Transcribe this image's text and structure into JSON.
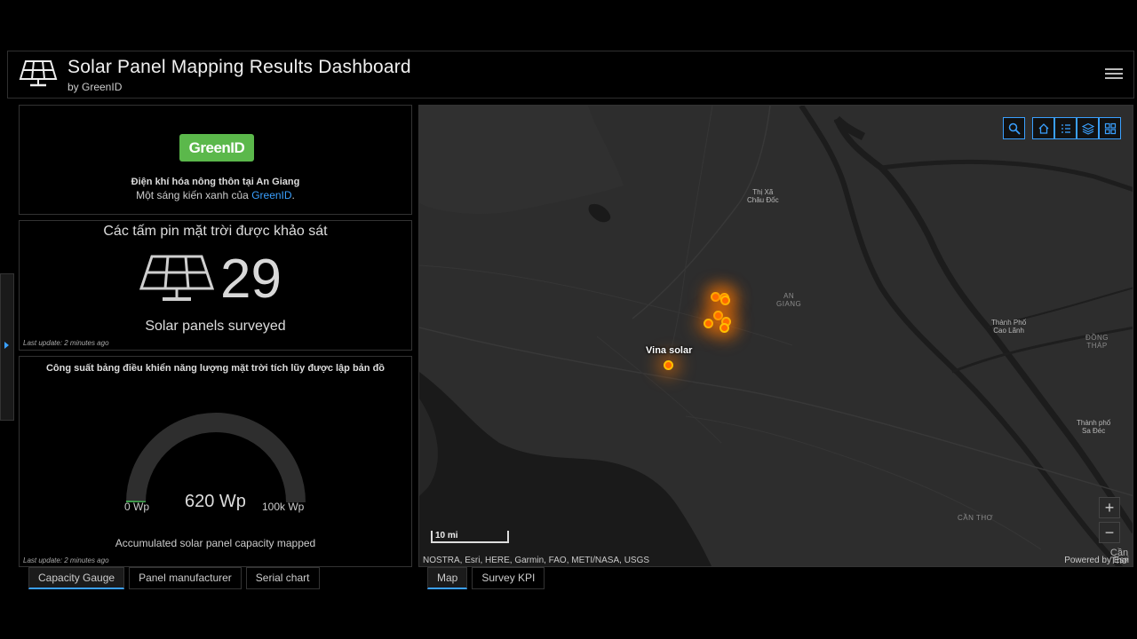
{
  "header": {
    "title": "Solar Panel Mapping Results Dashboard",
    "subtitle": "by GreenID"
  },
  "intro": {
    "logo_text": "GreenID",
    "line1": "Điện khí hóa nông thôn tại An Giang",
    "line2_prefix": "Một sáng kiến xanh của ",
    "line2_link": "GreenID",
    "line2_suffix": "."
  },
  "count": {
    "title": "Các tấm pin mặt trời được khảo sát",
    "value": "29",
    "subtitle": "Solar panels surveyed",
    "last_update": "Last update: 2 minutes ago"
  },
  "gauge": {
    "title": "Công suất bảng điều khiển năng lượng mặt trời tích lũy được lập bản đồ",
    "min_label": "0 Wp",
    "max_label": "100k Wp",
    "value_label": "620 Wp",
    "value": 620,
    "max": 100000,
    "subtitle": "Accumulated solar panel capacity mapped",
    "last_update": "Last update: 2 minutes ago",
    "track_color": "#2e2e2e",
    "fill_color": "#3fa34d"
  },
  "left_tabs": [
    "Capacity Gauge",
    "Panel manufacturer",
    "Serial chart"
  ],
  "map_tabs": [
    "Map",
    "Survey KPI"
  ],
  "map": {
    "labels": {
      "chau_doc": [
        "Thị Xã",
        "Châu Đốc"
      ],
      "an_giang": [
        "AN",
        "GIANG"
      ],
      "cao_lanh": [
        "Thành Phố",
        "Cao Lãnh"
      ],
      "dong_thap": [
        "ĐỒNG",
        "THÁP"
      ],
      "sa_dec": [
        "Thành phố",
        "Sa Đéc"
      ],
      "can_tho": "CẦN THƠ",
      "can_tho_city": "Cần Thơ"
    },
    "feature_label": "Vina solar",
    "scale": "10 mi",
    "attribution": "NOSTRA, Esri, HERE, Garmin, FAO, METI/NASA, USGS",
    "powered_by": "Powered by Esri",
    "zoom_in": "+",
    "zoom_out": "−",
    "tools": [
      "search-icon",
      "home-icon",
      "legend-icon",
      "layers-icon",
      "basemap-gallery-icon"
    ],
    "point_color": "#ff6a00",
    "accent_color": "#3aa0ff"
  }
}
